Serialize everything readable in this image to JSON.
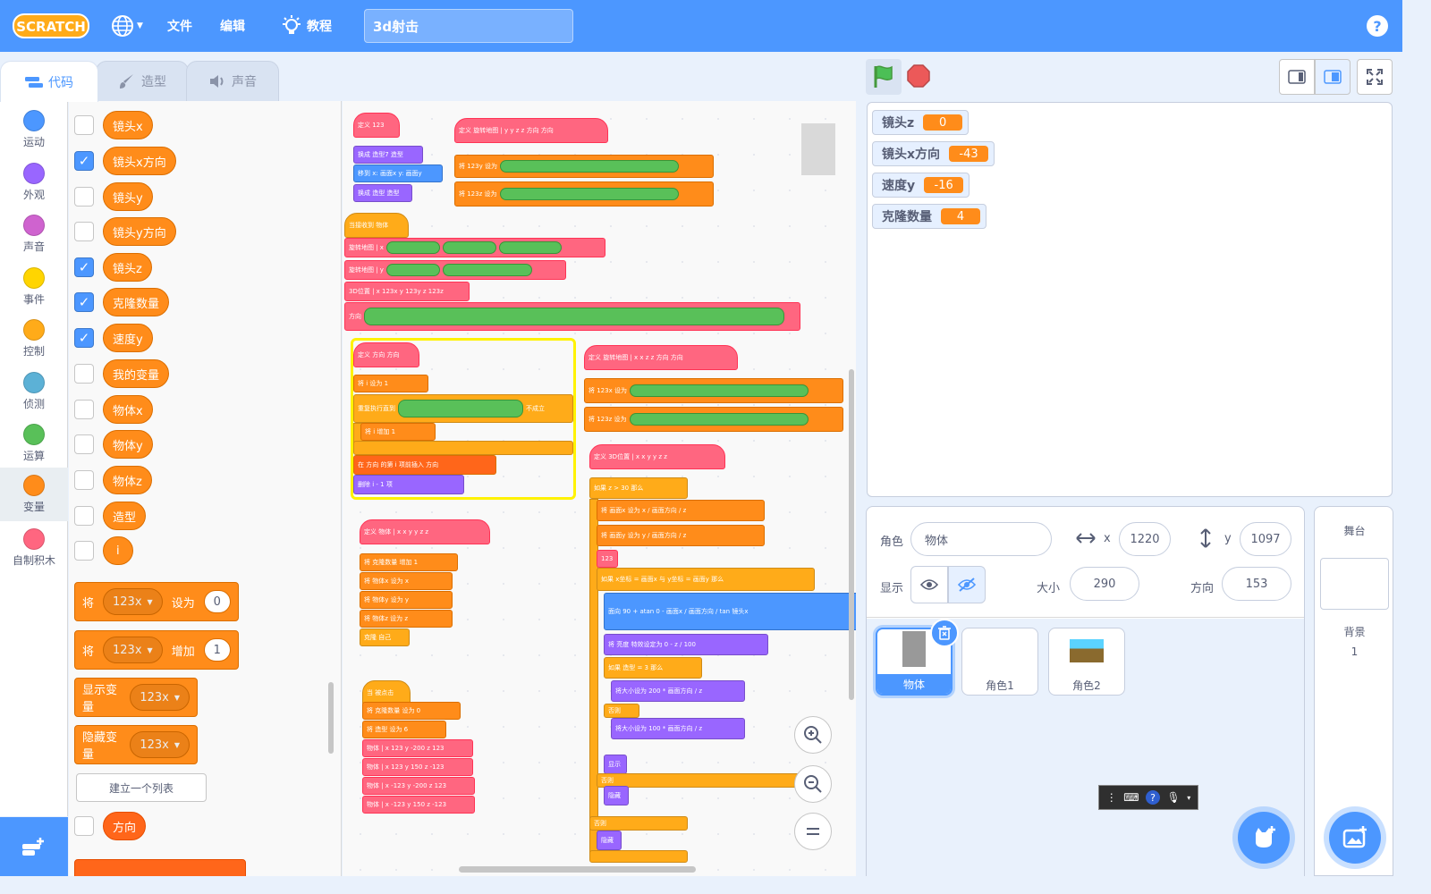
{
  "menubar": {
    "logo": "SCRATCH",
    "file": "文件",
    "edit": "编辑",
    "tutorials": "教程",
    "project_title": "3d射击",
    "help": "?"
  },
  "tabs": {
    "code": "代码",
    "costumes": "造型",
    "sounds": "声音"
  },
  "categories": [
    {
      "label": "运动",
      "color": "#4c97ff"
    },
    {
      "label": "外观",
      "color": "#9966ff"
    },
    {
      "label": "声音",
      "color": "#cf63cf"
    },
    {
      "label": "事件",
      "color": "#ffd500"
    },
    {
      "label": "控制",
      "color": "#ffab19"
    },
    {
      "label": "侦测",
      "color": "#5cb1d6"
    },
    {
      "label": "运算",
      "color": "#59c059"
    },
    {
      "label": "变量",
      "color": "#ff8c1a"
    },
    {
      "label": "自制积木",
      "color": "#ff6680"
    }
  ],
  "palette": {
    "variables": [
      {
        "name": "镜头x",
        "checked": false
      },
      {
        "name": "镜头x方向",
        "checked": true
      },
      {
        "name": "镜头y",
        "checked": false
      },
      {
        "name": "镜头y方向",
        "checked": false
      },
      {
        "name": "镜头z",
        "checked": true
      },
      {
        "name": "克隆数量",
        "checked": true
      },
      {
        "name": "速度y",
        "checked": true
      },
      {
        "name": "我的变量",
        "checked": false
      },
      {
        "name": "物体x",
        "checked": false
      },
      {
        "name": "物体y",
        "checked": false
      },
      {
        "name": "物体z",
        "checked": false
      },
      {
        "name": "造型",
        "checked": false
      },
      {
        "name": "i",
        "checked": false
      }
    ],
    "set_block": {
      "word": "将",
      "var": "123x",
      "action": "设为",
      "value": "0"
    },
    "change_block": {
      "word": "将",
      "var": "123x",
      "action": "增加",
      "value": "1"
    },
    "show_block": {
      "action": "显示变量",
      "var": "123x"
    },
    "hide_block": {
      "action": "隐藏变量",
      "var": "123x"
    },
    "make_list": "建立一个列表",
    "list_item": {
      "name": "方向",
      "checked": false
    }
  },
  "workspace": {
    "define_123": "定义 123",
    "switch_costume": "换成 造型7 造型",
    "goto_xy": "移到 x: 画面x y: 画面y",
    "switch_costume2": "换成 造型 造型",
    "define_rotate_yz": "定义 旋转地图 | y y z z 方向 方向",
    "set_123y": "将 123y 设为",
    "set_123z": "将 123z 设为",
    "hat_receive": "当接收到 物体",
    "rotate_x_call": "旋转地图 | x",
    "rotate_y_call": "旋转地图 | y",
    "pos3d_call": "3D位置 | x 123x y 123y z 123z",
    "direction_call": "方向",
    "define_direction": "定义 方向 方向",
    "set_i": "将 i 设为 1",
    "repeat_until": "重复执行直到",
    "not_hold": "不成立",
    "change_i": "将 i 增加 1",
    "insert": "在 方向 的第 i 项前插入 方向",
    "delete_item": "删除 i - 1 项",
    "define_object": "定义 物体 | x x y y z z",
    "change_clone": "将 克隆数量 增加 1",
    "set_objx": "将 物体x 设为 x",
    "set_objy": "将 物体y 设为 y",
    "set_objz": "将 物体z 设为 z",
    "clone_self": "克隆 自己",
    "flag_hat": "当 被点击",
    "set_clone0": "将 克隆数量 设为 0",
    "set_costume6": "将 造型 设为 6",
    "obj_calls": [
      "物体 | x 123 y -200 z 123",
      "物体 | x 123 y 150 z -123",
      "物体 | x -123 y -200 z 123",
      "物体 | x -123 y 150 z -123"
    ],
    "define_rotate_xz": "定义 旋转地图 | x x z z 方向 方向",
    "set_123x": "将 123x 设为",
    "set_123z_b": "将 123z 设为",
    "define_pos3d": "定义 3D位置 | x x y y z z",
    "if_z": "如果 z > 30 那么",
    "set_screenx": "将 画面x 设为 x / 画面方向 / z",
    "set_screeny": "将 画面y 设为 y / 画面方向 / z",
    "call_123": "123",
    "if_xy": "如果 x坐标 = 画面x 与 y坐标 = 画面y 那么",
    "face_dir": "面向 90 + atan 0 - 画面x / 画面方向 / tan 镜头x",
    "set_effect": "将 亮度 特效设定为 0 - z / 100",
    "if_costume": "如果 造型 = 3 那么",
    "set_size1": "将大小设为 200 * 画面方向 / z",
    "else1": "否则",
    "set_size2": "将大小设为 100 * 画面方向 / z",
    "show": "显示",
    "else2": "否则",
    "hide": "隐藏",
    "else3": "否则",
    "hide2": "隐藏"
  },
  "monitors": [
    {
      "label": "镜头z",
      "value": "0"
    },
    {
      "label": "镜头x方向",
      "value": "-43"
    },
    {
      "label": "速度y",
      "value": "-16"
    },
    {
      "label": "克隆数量",
      "value": "4"
    }
  ],
  "sprite_info": {
    "sprite_label": "角色",
    "sprite_name": "物体",
    "x_label": "x",
    "x_value": "1220",
    "y_label": "y",
    "y_value": "1097",
    "show_label": "显示",
    "size_label": "大小",
    "size_value": "290",
    "direction_label": "方向",
    "direction_value": "153"
  },
  "sprites": [
    {
      "name": "物体",
      "selected": true
    },
    {
      "name": "角色1",
      "selected": false
    },
    {
      "name": "角色2",
      "selected": false
    }
  ],
  "stage_pane": {
    "title": "舞台",
    "backdrops_label": "背景",
    "backdrops_count": "1"
  }
}
